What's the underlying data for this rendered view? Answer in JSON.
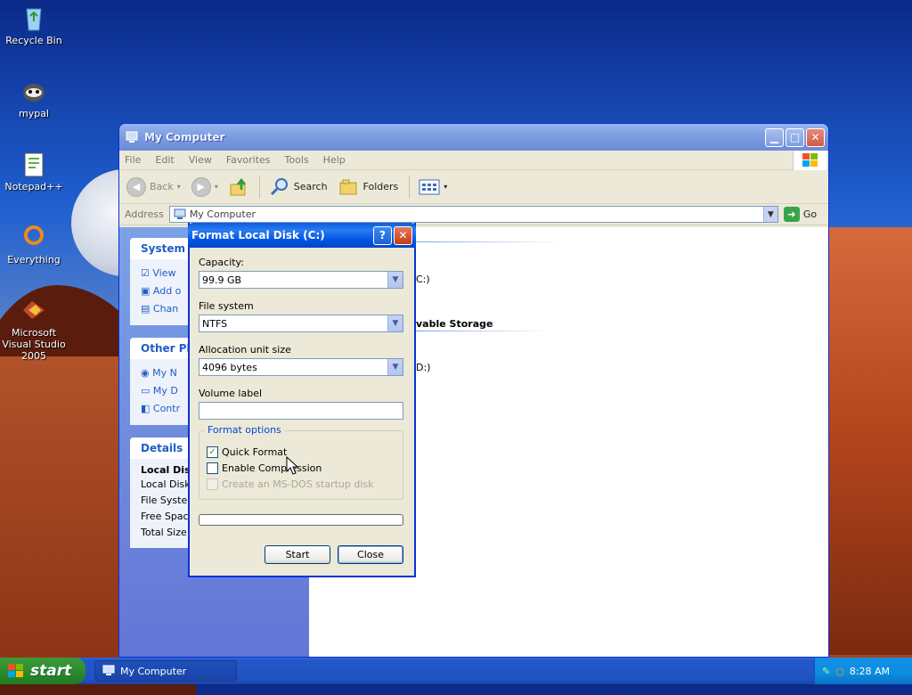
{
  "desktop": {
    "icons": [
      {
        "label": "Recycle Bin",
        "icon": "recycle-bin-icon"
      },
      {
        "label": "mypal",
        "icon": "mypal-icon"
      },
      {
        "label": "Notepad++",
        "icon": "notepad-plus-plus-icon"
      },
      {
        "label": "Everything",
        "icon": "everything-icon"
      },
      {
        "label": "Microsoft Visual Studio 2005",
        "icon": "visual-studio-icon"
      }
    ]
  },
  "explorer": {
    "title": "My Computer",
    "menu": [
      "File",
      "Edit",
      "View",
      "Favorites",
      "Tools",
      "Help"
    ],
    "toolbar": {
      "back": "Back",
      "search": "Search",
      "folders": "Folders"
    },
    "address": {
      "label": "Address",
      "value": "My Computer",
      "go": "Go"
    },
    "taskpane": {
      "system_tasks": {
        "title": "System T",
        "items": [
          "View",
          "Add o",
          "Chan"
        ]
      },
      "other_places": {
        "title": "Other Pla",
        "items": [
          "My N",
          "My D",
          "Contr"
        ]
      },
      "details": {
        "title": "Details",
        "lines": [
          "Local Dis",
          "Local Disk",
          "File Syster",
          "Free Spac",
          "Total Size"
        ]
      }
    },
    "main_fragments": {
      "drive_c": "C:)",
      "removable": "vable Storage",
      "drive_d": "D:)"
    }
  },
  "format_dialog": {
    "title": "Format Local Disk (C:)",
    "capacity_label": "Capacity:",
    "capacity_value": "99.9 GB",
    "filesystem_label": "File system",
    "filesystem_value": "NTFS",
    "alloc_label": "Allocation unit size",
    "alloc_value": "4096 bytes",
    "volume_label": "Volume label",
    "volume_value": "",
    "options_label": "Format options",
    "quick_format": "Quick Format",
    "quick_format_checked": true,
    "enable_compression": "Enable Compression",
    "enable_compression_checked": false,
    "msdos_disk": "Create an MS-DOS startup disk",
    "start": "Start",
    "close": "Close",
    "progress": 0
  },
  "taskbar": {
    "start": "start",
    "task": "My Computer",
    "clock": "8:28 AM"
  }
}
